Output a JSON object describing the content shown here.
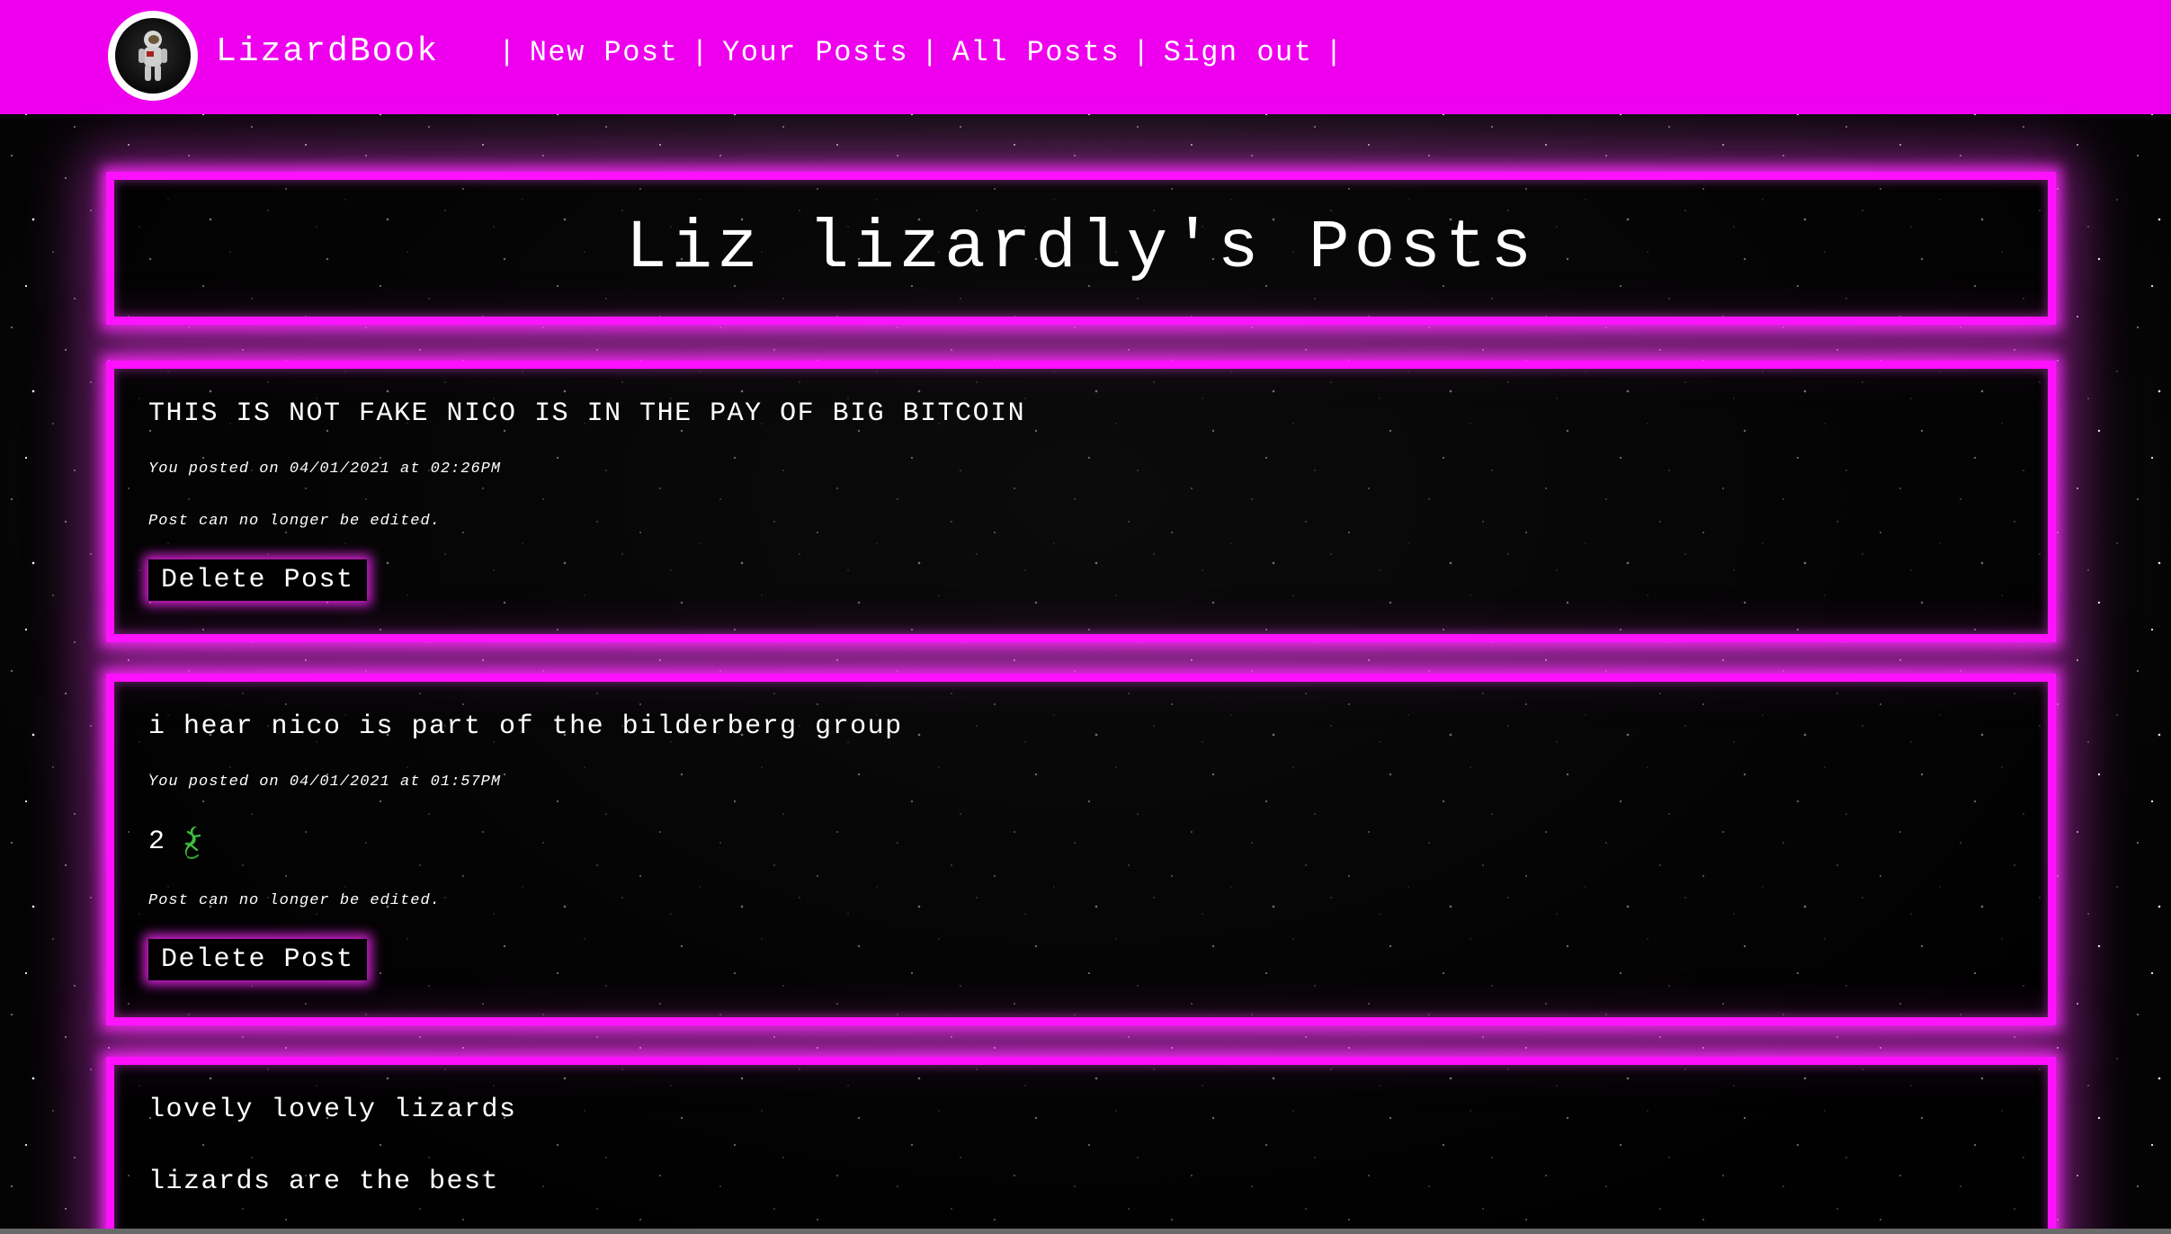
{
  "nav": {
    "brand": "LizardBook",
    "separator": "|",
    "links": [
      {
        "label": "New Post"
      },
      {
        "label": "Your Posts"
      },
      {
        "label": "All Posts"
      },
      {
        "label": "Sign out"
      }
    ]
  },
  "page": {
    "title": "Liz lizardly's Posts"
  },
  "posts": [
    {
      "title": "THIS IS NOT FAKE NICO IS IN THE PAY OF BIG BITCOIN",
      "meta": "You posted on 04/01/2021 at 02:26PM",
      "note": "Post can no longer be edited.",
      "delete_label": "Delete Post"
    },
    {
      "title": "i hear nico is part of the bilderberg group",
      "meta": "You posted on 04/01/2021 at 01:57PM",
      "likes": "2",
      "like_icon": "lizard-icon",
      "note": "Post can no longer be edited.",
      "delete_label": "Delete Post"
    },
    {
      "title": "lovely lovely lizards",
      "body": "lizards are the best"
    }
  ],
  "colors": {
    "accent": "#ee00ee",
    "glow": "#ff10ff",
    "text": "#ffffff",
    "background": "#050505"
  }
}
